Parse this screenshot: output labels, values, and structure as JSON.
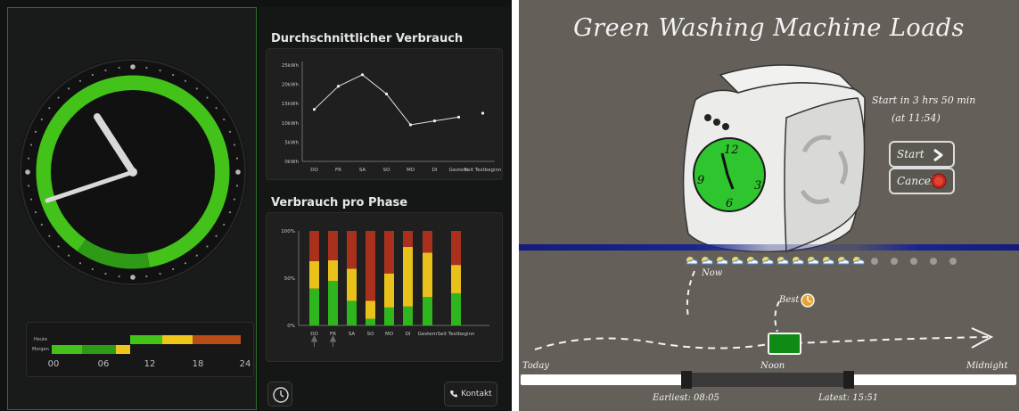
{
  "left_app": {
    "clock": {
      "hour_labels": [
        "00",
        "06",
        "12",
        "18",
        "24"
      ],
      "row_labels": [
        "Heute",
        "Morgen"
      ],
      "colors": {
        "green": "#43c21a",
        "dark_green": "#2e9a15",
        "yellow": "#eec518",
        "red": "#b84d18",
        "dark_red": "#732914"
      }
    },
    "average": {
      "title": "Durchschnittlicher Verbrauch",
      "chart_data": {
        "type": "line",
        "categories": [
          "DO",
          "FR",
          "SA",
          "SO",
          "MO",
          "DI",
          "Gestern",
          "Seit Testbeginn"
        ],
        "series": [
          {
            "values": [
              13.5,
              19.5,
              22.5,
              17.5,
              9.5,
              10.5,
              11.5,
              12.5
            ]
          }
        ],
        "yticks": [
          "0kWh",
          "5kWh",
          "10kWh",
          "15kWh",
          "20kWh",
          "25kWh"
        ],
        "ylim": [
          0,
          25
        ]
      }
    },
    "phases": {
      "title": "Verbrauch pro Phase",
      "chart_data": {
        "type": "bar",
        "categories": [
          "DO",
          "FR",
          "SA",
          "SO",
          "MO",
          "DI",
          "Gestern",
          "Seit Testbeginn"
        ],
        "series": [
          {
            "values": [
              39,
              47,
              26,
              7,
              19,
              20,
              30,
              34
            ],
            "color": "#2fb51e"
          },
          {
            "values": [
              29,
              22,
              34,
              19,
              36,
              63,
              47,
              30
            ],
            "color": "#e8c21a"
          },
          {
            "values": [
              32,
              31,
              40,
              74,
              45,
              17,
              23,
              36
            ],
            "color": "#a8301d"
          }
        ],
        "yticks": [
          "0%",
          "50%",
          "100%"
        ],
        "ylim": [
          0,
          100
        ]
      }
    },
    "kontakt_label": "Kontakt"
  },
  "right_app": {
    "title": "Green Washing Machine Loads",
    "start_info_line1": "Start in 3 hrs 50 min",
    "start_info_line2": "(at 11:54)",
    "start_label": "Start",
    "cancel_label": "Cancel",
    "clock_numbers": [
      "12",
      "3",
      "6",
      "9"
    ],
    "now_label": "Now",
    "best_label": "Best",
    "today_label": "Today",
    "noon_label": "Noon",
    "midnight_label": "Midnight",
    "earliest_label": "Earliest: 08:05",
    "latest_label": "Latest: 15:51",
    "forecast": {
      "active_slots": 12,
      "inactive_slots": 5,
      "active_icon": "weather-icon",
      "inactive_icon": "dot-icon"
    },
    "colors": {
      "background": "#646059",
      "selection_green": "#0f8a15",
      "blue_band": "#18258e"
    }
  }
}
